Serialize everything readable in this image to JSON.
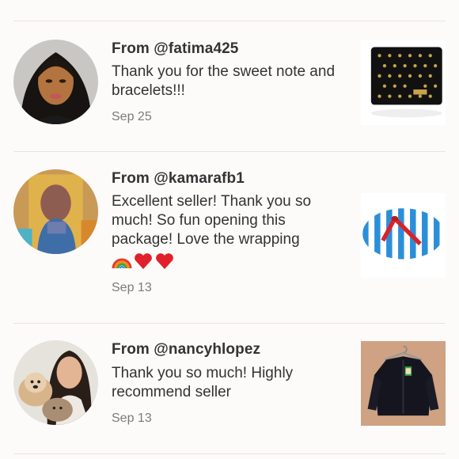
{
  "reviews": [
    {
      "from": "From @fatima425",
      "message": "Thank you for the sweet note and bracelets!!!",
      "date": "Sep 25",
      "avatar_icon": "profile-photo",
      "thumb_icon": "black-studded-handbag"
    },
    {
      "from": "From @kamarafb1",
      "message": "Excellent seller! Thank you so much! So fun opening this package! Love the wrapping",
      "emojis": [
        "rainbow",
        "red-heart",
        "red-heart"
      ],
      "date": "Sep 13",
      "avatar_icon": "profile-photo",
      "thumb_icon": "striped-flip-flop-bag"
    },
    {
      "from": "From @nancyhlopez",
      "message": "Thank you so much! Highly recommend seller",
      "date": "Sep 13",
      "avatar_icon": "profile-photo-with-dogs",
      "thumb_icon": "black-jacket-on-hanger"
    }
  ],
  "colors": {
    "text": "#333333",
    "muted": "#7b7b7b",
    "divider": "#e7e3e1",
    "background": "#fdfbfa"
  }
}
